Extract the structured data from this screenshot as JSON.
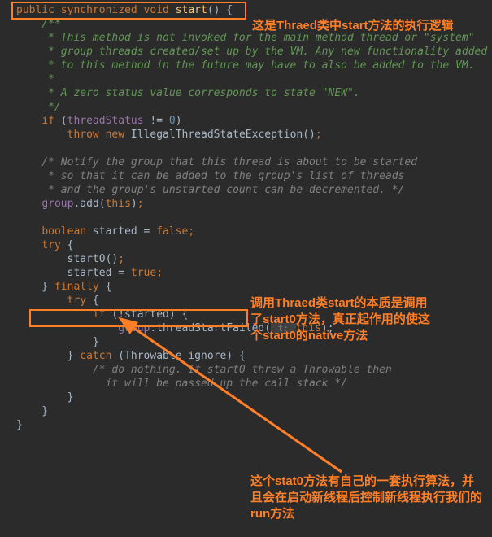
{
  "code": {
    "l1_public": "public",
    "l1_sync": "synchronized",
    "l1_void": "void",
    "l1_method": "start",
    "l1_rest": "() {",
    "l2": "    /**",
    "l3": "     * This method is not invoked for the main method thread or \"system\"",
    "l4": "     * group threads created/set up by the VM. Any new functionality added",
    "l5": "     * to this method in the future may have to also be added to the VM.",
    "l6": "     *",
    "l7": "     * A zero status value corresponds to state \"NEW\".",
    "l8": "     */",
    "l9_if": "if",
    "l9_open": " (",
    "l9_field": "threadStatus",
    "l9_ne": " != ",
    "l9_zero": "0",
    "l9_close": ")",
    "l10_throw": "throw",
    "l10_new": "new",
    "l10_ex": "IllegalThreadStateException",
    "l10_rest": "()",
    "l12": "    /* Notify the group that this thread is about to be started",
    "l13": "     * so that it can be added to the group's list of threads",
    "l14": "     * and the group's unstarted count can be decremented. */",
    "l15_group": "group",
    "l15_add": ".add(",
    "l15_this": "this",
    "l15_close": ")",
    "l17_bool": "boolean",
    "l17_var": " started = ",
    "l17_false": "false",
    "l18_try": "try",
    "l18_brace": " {",
    "l19_call": "        start0()",
    "l20_var": "        started = ",
    "l20_true": "true",
    "l21_close": "    } ",
    "l21_finally": "finally",
    "l21_brace": " {",
    "l22_try": "try",
    "l22_brace": " {",
    "l23_if": "if",
    "l23_cond": " (!started) {",
    "l24_group": "group",
    "l24_call": ".threadStartFailed(",
    "l24_hint": " t: ",
    "l24_this": "this",
    "l24_close": ");",
    "l25_close": "            }",
    "l26_close": "        } ",
    "l26_catch": "catch",
    "l26_rest": " (Throwable ignore) {",
    "l27": "            /* do nothing. If start0 threw a Throwable then",
    "l28": "              it will be passed up the call stack */",
    "l29": "        }",
    "l30": "    }",
    "l31": "}"
  },
  "annotations": {
    "a1": "这是Thraed类中start方法的执行逻辑",
    "a2": "调用Thraed类start的本质是调用了start0方法，真正起作用的使这个start0的native方法",
    "a3": "这个stat0方法有自己的一套执行算法，并且会在启动新线程后控制新线程执行我们的run方法"
  }
}
